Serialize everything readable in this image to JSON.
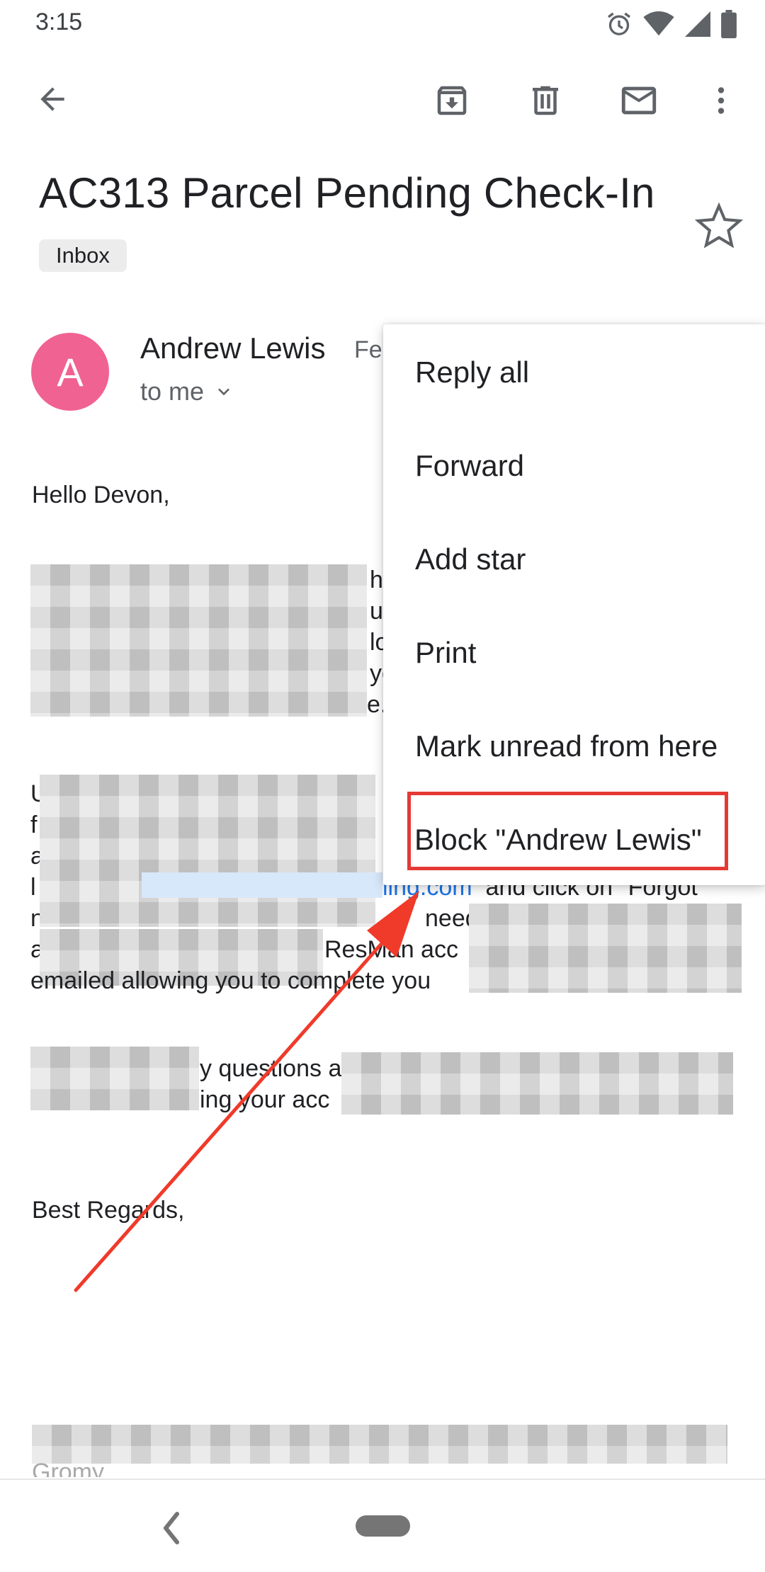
{
  "status_bar": {
    "time": "3:15"
  },
  "email": {
    "subject": "AC313 Parcel Pending Check-In",
    "label": "Inbox",
    "sender_initial": "A",
    "sender_name": "Andrew Lewis",
    "date_fragment": "Feb",
    "recipient": "to me",
    "greeting": "Hello Devon,",
    "p1_right": [
      "h",
      "u",
      "lo",
      "yo",
      "e."
    ],
    "p2_left": [
      "U",
      "f",
      "a",
      "l",
      "n",
      "a",
      "e"
    ],
    "p2_line_link": "ling.com",
    "p2_line_after": "and click on \"Forgot",
    "p2_line5": "need",
    "p2_line6": "ResMan acc",
    "p2_line7": "emailed allowing you to complete you",
    "p3_line1": "y questions a",
    "p3_line2": "ing your acc",
    "closing": "Best Regards,",
    "footer_partial": "Gromy"
  },
  "menu": {
    "items": [
      "Reply all",
      "Forward",
      "Add star",
      "Print",
      "Mark unread from here",
      "Block \"Andrew Lewis\""
    ]
  },
  "colors": {
    "avatar": "#f06292",
    "highlight": "#e53935",
    "arrow": "#f03a2a",
    "link": "#1a73e8"
  },
  "icons": [
    "back-arrow-icon",
    "archive-icon",
    "trash-icon",
    "mail-icon",
    "more-vert-icon",
    "star-icon",
    "chevron-down-icon",
    "alarm-icon",
    "wifi-icon",
    "signal-icon",
    "battery-icon"
  ]
}
